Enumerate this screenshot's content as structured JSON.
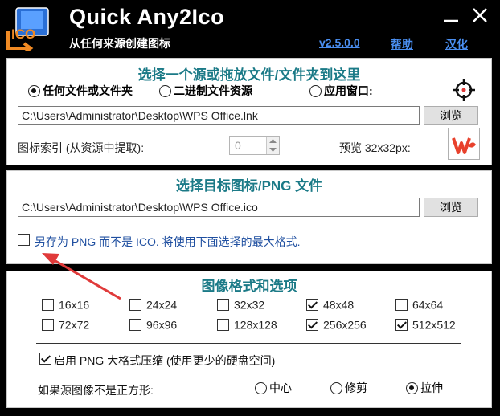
{
  "header": {
    "title": "Quick Any2Ico",
    "subtitle": "从任何来源创建图标",
    "logo_text": "ICO",
    "version": "v2.5.0.0",
    "help": "帮助",
    "localize": "汉化"
  },
  "source": {
    "title": "选择一个源或拖放文件/文件夹到这里",
    "options": [
      "任何文件或文件夹",
      "二进制文件资源",
      "应用窗口:"
    ],
    "selected_option": "任何文件或文件夹",
    "path": "C:\\Users\\Administrator\\Desktop\\WPS Office.lnk",
    "browse": "浏览",
    "index_label": "图标索引 (从资源中提取):",
    "index_value": "0",
    "preview_label": "预览 32x32px:",
    "target_icon": "crosshair-icon",
    "preview_icon": "wps-logo-icon"
  },
  "target": {
    "title": "选择目标图标/PNG 文件",
    "path": "C:\\Users\\Administrator\\Desktop\\WPS Office.ico",
    "browse": "浏览",
    "save_as_png": "另存为 PNG 而不是 ICO. 将使用下面选择的最大格式.",
    "save_as_png_checked": false
  },
  "formats": {
    "title": "图像格式和选项",
    "sizes": [
      {
        "label": "16x16",
        "checked": false
      },
      {
        "label": "24x24",
        "checked": false
      },
      {
        "label": "32x32",
        "checked": false
      },
      {
        "label": "48x48",
        "checked": true
      },
      {
        "label": "64x64",
        "checked": false
      },
      {
        "label": "72x72",
        "checked": false
      },
      {
        "label": "96x96",
        "checked": false
      },
      {
        "label": "128x128",
        "checked": false
      },
      {
        "label": "256x256",
        "checked": true
      },
      {
        "label": "512x512",
        "checked": true
      }
    ],
    "png_compression": "启用 PNG 大格式压缩 (使用更少的硬盘空间)",
    "png_compression_checked": true,
    "nonsquare_label": "如果源图像不是正方形:",
    "nonsquare_options": [
      "中心",
      "修剪",
      "拉伸"
    ],
    "nonsquare_selected": "拉伸"
  },
  "colors": {
    "accent_teal": "#1b7a87",
    "link_blue": "#4a8ef0",
    "arrow_red": "#e03a3a"
  }
}
